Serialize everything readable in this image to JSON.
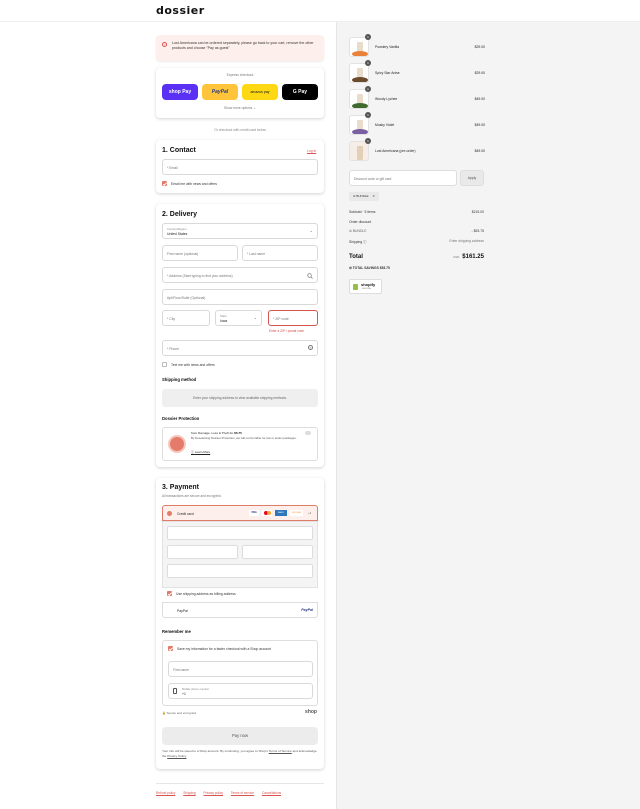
{
  "header": {
    "logo": "dossier"
  },
  "alert": {
    "text": "Lost Americana can be ordered separately, please go back to your cart, remove the other products and choose \"Pay as guest\""
  },
  "express": {
    "title": "Express checkout",
    "buttons": [
      {
        "label": "shop Pay",
        "name": "shop-pay"
      },
      {
        "label": "PayPal",
        "name": "paypal"
      },
      {
        "label": "amazon pay",
        "name": "amazon-pay"
      },
      {
        "label": "G Pay",
        "name": "google-pay"
      }
    ],
    "show_more": "Show more options ⌄",
    "or_text": "Or checkout with credit card below"
  },
  "contact": {
    "title": "1. Contact",
    "login": "Log in",
    "email_placeholder": "* Email",
    "news_label": "Email me with news and offers"
  },
  "delivery": {
    "title": "2. Delivery",
    "country_label": "Country/Region",
    "country_value": "United States",
    "first_name": "First name (optional)",
    "last_name": "* Last name",
    "address": "* Address (Start typing to find your address)",
    "apt": "Apt/Floor/Suite (Optional)",
    "city": "* City",
    "state_label": "State",
    "state_value": "Iowa",
    "zip": "* ZIP code",
    "zip_error": "Enter a ZIP / postal code",
    "phone": "* Phone",
    "text_news": "Text me with news and offers",
    "shipping_title": "Shipping method",
    "shipping_box": "Enter your shipping address to view available shipping methods.",
    "protection_title": "Dossier Protection",
    "protection_line1": "from Damage, Loss & Theft for",
    "protection_price": "$6.75",
    "protection_line2": "By Deselecting Dossier Protection, we will not be liable for lost or stolen packages.",
    "learn_more": "Learn More"
  },
  "payment": {
    "title": "3. Payment",
    "subtitle": "All transactions are secure and encrypted.",
    "credit_card": "Credit card",
    "cards": [
      "VISA",
      "MC",
      "AMEX",
      "DISCOVER",
      "+4"
    ],
    "billing_same": "Use shipping address as billing address",
    "paypal": "PayPal",
    "paypal_logo": "PayPal",
    "remember_title": "Remember me",
    "save_info": "Save my information for a faster checkout with a Shop account",
    "first_name": "First name",
    "mobile_label": "Mobile phone number",
    "mobile_value": "+1",
    "secure": "Secure and encrypted",
    "shop": "shop",
    "pay_now": "Pay now",
    "terms_1": "Your info will be saved to a Shop account. By continuing, you agree to Shop's",
    "terms_link1": "Terms of Service",
    "terms_2": "and acknowledge the",
    "terms_link2": "Privacy Policy"
  },
  "footer": {
    "links": [
      "Refund policy",
      "Shipping",
      "Privacy policy",
      "Terms of service",
      "Cancellations"
    ]
  },
  "summary": {
    "items": [
      {
        "qty": "1",
        "name": "Powdery Vanilla",
        "price": "$29.00"
      },
      {
        "qty": "1",
        "name": "Spicy Star Anise",
        "price": "$29.00"
      },
      {
        "qty": "1",
        "name": "Woody Lychee",
        "price": "$49.00"
      },
      {
        "qty": "1",
        "name": "Musky Violet",
        "price": "$49.00"
      },
      {
        "qty": "1",
        "name": "Lost Americana (pre-order)",
        "price": "$49.00"
      }
    ],
    "discount_placeholder": "Discount code or gift card",
    "apply": "Apply",
    "tag": "BUNDLE",
    "subtotal_label": "Subtotal · 5 items",
    "subtotal": "$215.00",
    "order_discount": "Order discount",
    "bundle": "BUNDLE",
    "bundle_amount": "- $53.75",
    "shipping_label": "Shipping",
    "shipping_value": "Enter shipping address",
    "total_label": "Total",
    "currency": "USD",
    "total": "$161.25",
    "savings_label": "TOTAL SAVINGS",
    "savings": "$53.75",
    "shopify": "shopify",
    "shopify_sub": "SECURE"
  }
}
